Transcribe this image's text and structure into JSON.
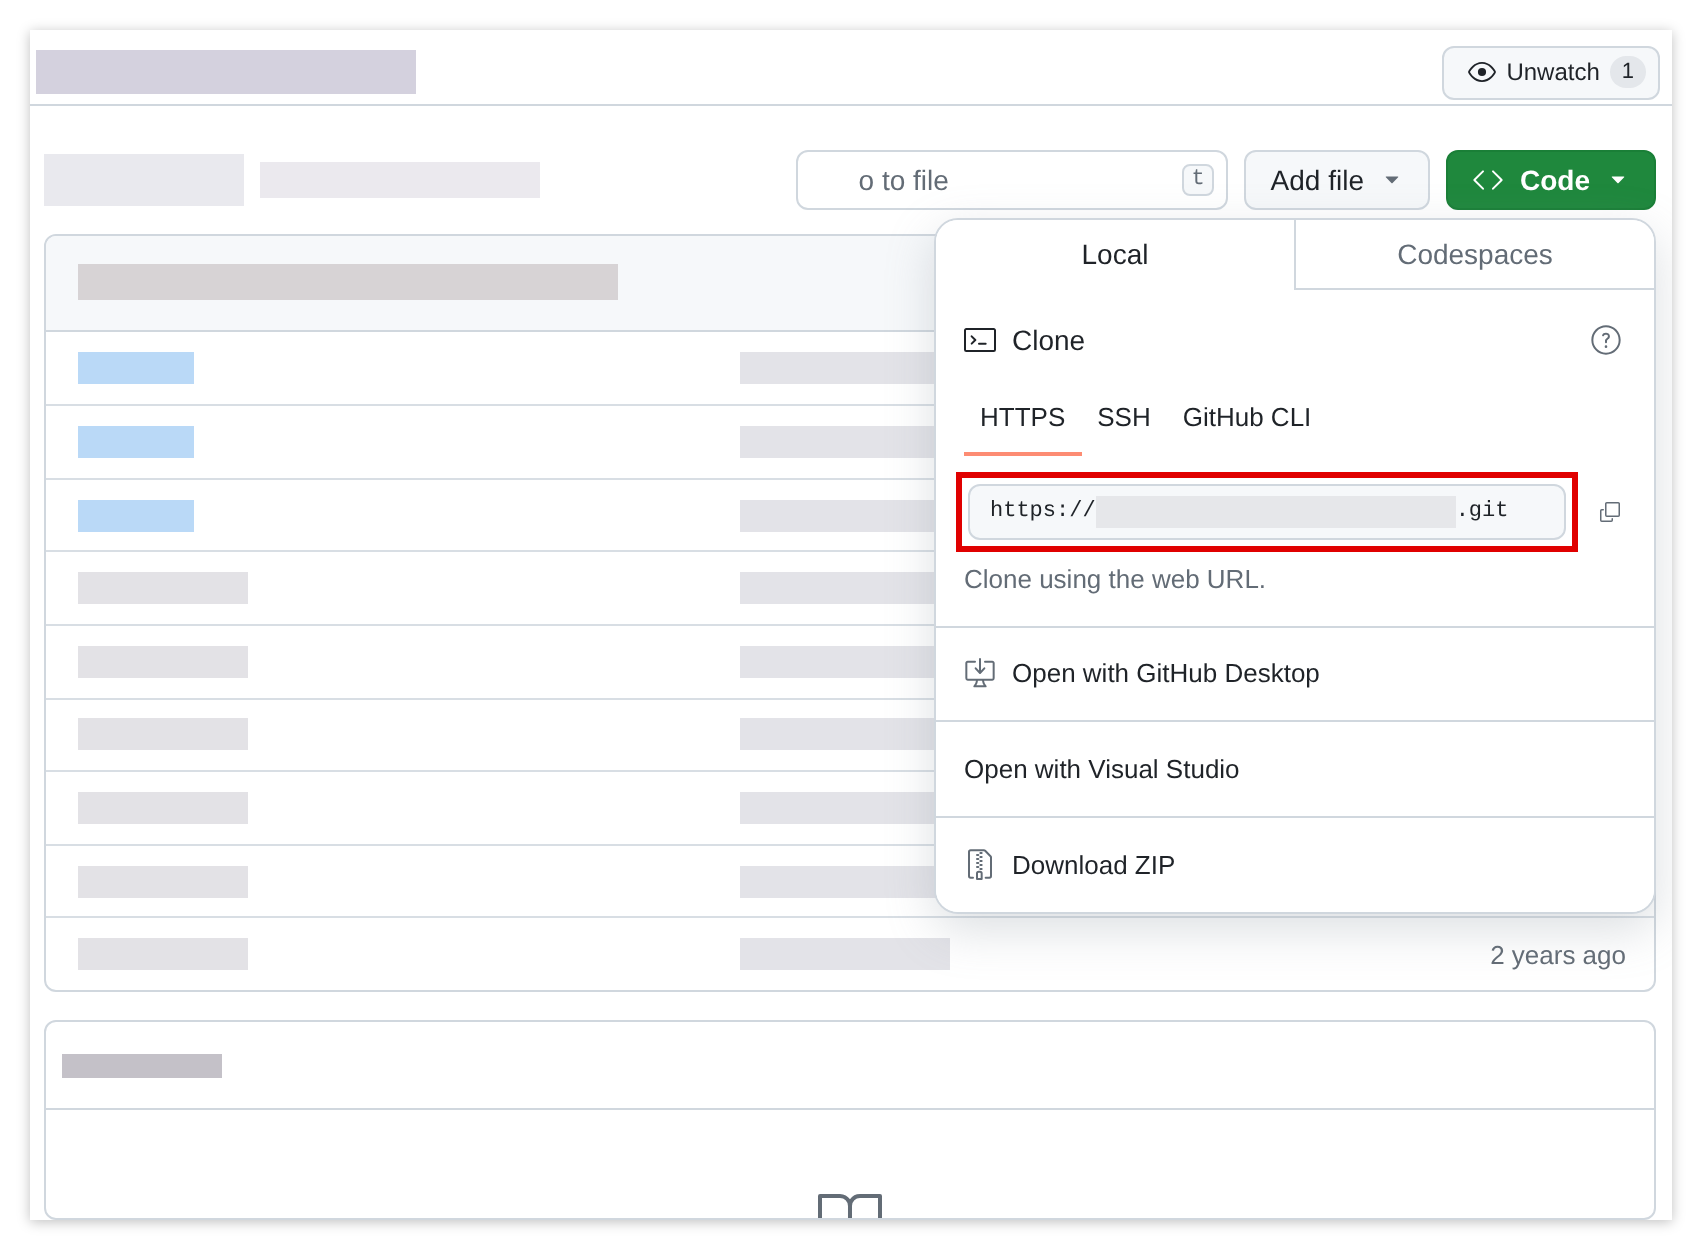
{
  "repo_header": {
    "name_redacted": true,
    "watch_button": {
      "label": "Unwatch",
      "count": "1"
    }
  },
  "toolbar": {
    "branch_redacted": true,
    "file_search": {
      "placeholder": "o to file",
      "shortcut": "t"
    },
    "add_file_button": "Add file",
    "code_button": "Code"
  },
  "file_table": {
    "header_redacted": true,
    "rows": [
      {
        "redacted": true,
        "folder": true
      },
      {
        "redacted": true,
        "folder": true
      },
      {
        "redacted": true,
        "folder": true
      },
      {
        "redacted": true,
        "folder": false
      },
      {
        "redacted": true,
        "folder": false
      },
      {
        "redacted": true,
        "folder": false
      },
      {
        "redacted": true,
        "folder": false
      },
      {
        "redacted": true,
        "folder": false
      },
      {
        "redacted": true,
        "folder": false,
        "time": "2 years ago"
      }
    ]
  },
  "clone_menu": {
    "tabs": [
      {
        "label": "Local",
        "selected": true
      },
      {
        "label": "Codespaces",
        "selected": false
      }
    ],
    "heading": "Clone",
    "protocols": [
      {
        "label": "HTTPS",
        "selected": true
      },
      {
        "label": "SSH",
        "selected": false
      },
      {
        "label": "GitHub CLI",
        "selected": false
      }
    ],
    "url": {
      "prefix": "https://",
      "suffix": ".git",
      "highlighted": true
    },
    "hint": "Clone using the web URL.",
    "actions": [
      {
        "label": "Open with GitHub Desktop",
        "kind": "desktop"
      },
      {
        "label": "Open with Visual Studio",
        "kind": "plain"
      },
      {
        "label": "Download ZIP",
        "kind": "zip"
      }
    ]
  },
  "readme": {
    "title_redacted": true
  }
}
